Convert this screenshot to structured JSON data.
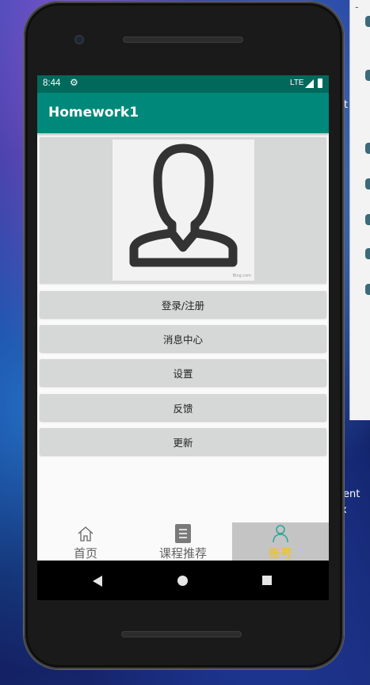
{
  "side_window": {
    "dash": "-"
  },
  "desktop_peek": {
    "text1": "ent",
    "text2": "x",
    "text3": "t"
  },
  "status_bar": {
    "time": "8:44",
    "network": "LTE"
  },
  "app_bar": {
    "title": "Homework1"
  },
  "avatar": {
    "watermark": "Bing.com"
  },
  "menu": {
    "items": [
      {
        "label": "登录/注册"
      },
      {
        "label": "消息中心"
      },
      {
        "label": "设置"
      },
      {
        "label": "反馈"
      },
      {
        "label": "更新"
      }
    ]
  },
  "bottom_nav": {
    "items": [
      {
        "label": "首页",
        "icon": "home-icon",
        "color": "#616161"
      },
      {
        "label": "课程推荐",
        "icon": "document-icon",
        "color": "#616161"
      },
      {
        "label": "账号",
        "icon": "person-icon",
        "color": "#f4c20d"
      }
    ],
    "active_index": 2,
    "active_icon_color": "#26a69a"
  },
  "colors": {
    "status_bar": "#00695c",
    "app_bar": "#00897b",
    "button_bg": "#d6d7d7"
  }
}
